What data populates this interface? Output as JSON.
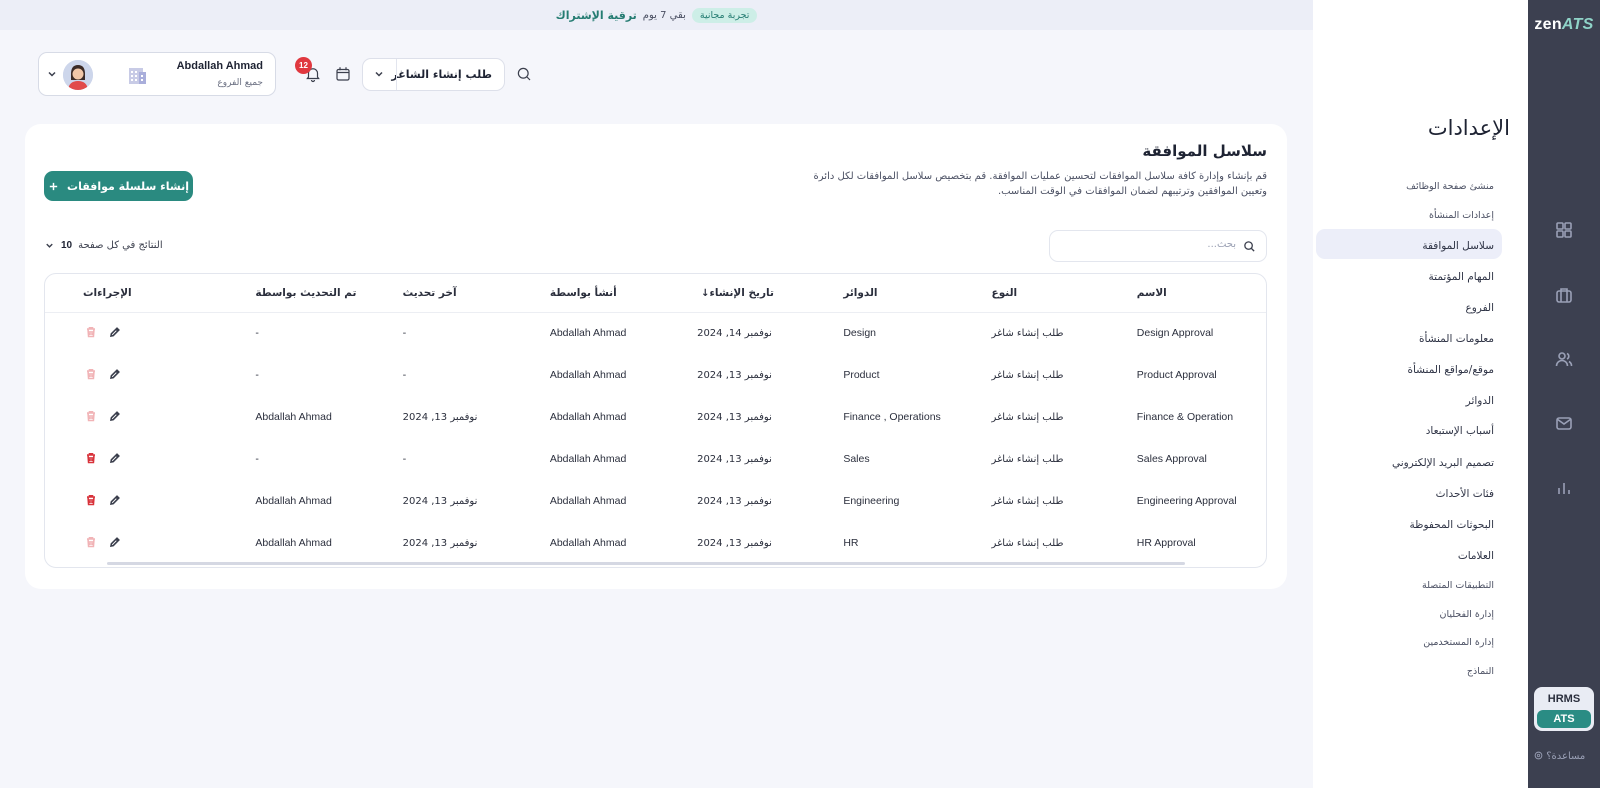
{
  "banner": {
    "trial_badge": "تجربة مجانية",
    "days_left": "بقي 7 يوم",
    "upgrade": "ترقية الإشتراك"
  },
  "brand": {
    "logo_zen": "zen",
    "logo_ats": "ATS"
  },
  "rail": {
    "icons": [
      "grid-icon",
      "briefcase-icon",
      "users-icon",
      "mail-icon",
      "chart-icon"
    ],
    "hrms": "HRMS",
    "ats": "ATS",
    "help": "مساعدة؟"
  },
  "settings": {
    "title": "الإعدادات",
    "items": [
      "منشئ صفحة الوظائف",
      "إعدادات المنشأة",
      "سلاسل الموافقة",
      "المهام المؤتمتة",
      "الفروع",
      "معلومات المنشأة",
      "موقع/مواقع المنشأة",
      "الدوائر",
      "أسباب الإستبعاد",
      "تصميم البريد الإلكتروني",
      "فئات الأحداث",
      "البحوثات المحفوظة",
      "العلامات",
      "التطبيقات المتصلة",
      "إدارة الفحليان",
      "إدارة المستخدمين",
      "النماذج"
    ],
    "active_index": 2
  },
  "header": {
    "user_name": "Abdallah Ahmad",
    "user_branch": "جميع الفروع",
    "notifications_count": "12",
    "requisition_label": "طلب إنشاء الشاغر"
  },
  "main": {
    "title": "سلاسل الموافقة",
    "description": "قم بإنشاء وإدارة كافة سلاسل الموافقات لتحسين عمليات الموافقة. قم بتخصيص سلاسل الموافقات لكل دائرة وتعيين الموافقين وترتيبهم لضمان الموافقات في الوقت المناسب.",
    "create_button": "إنشاء سلسلة موافقات",
    "search_placeholder": "بحث...",
    "per_page_label": "النتائج في كل صفحة",
    "per_page_value": "10"
  },
  "table": {
    "columns": [
      "الاسم",
      "النوع",
      "الدوائر",
      "تاريخ الإنشاء",
      "أنشأ بواسطة",
      "آخر تحديث",
      "تم التحديث بواسطة",
      "الإجراءات"
    ],
    "rows": [
      {
        "name": "Design Approval",
        "type": "طلب إنشاء شاغر",
        "departments": "Design",
        "created": "نوفمبر 14, 2024",
        "created_by": "Abdallah Ahmad",
        "updated": "-",
        "updated_by": "-",
        "delete_enabled": false
      },
      {
        "name": "Product Approval",
        "type": "طلب إنشاء شاغر",
        "departments": "Product",
        "created": "نوفمبر 13, 2024",
        "created_by": "Abdallah Ahmad",
        "updated": "-",
        "updated_by": "-",
        "delete_enabled": false
      },
      {
        "name": "Finance & Operation",
        "type": "طلب إنشاء شاغر",
        "departments": "Finance , Operations",
        "created": "نوفمبر 13, 2024",
        "created_by": "Abdallah Ahmad",
        "updated": "نوفمبر 13, 2024",
        "updated_by": "Abdallah Ahmad",
        "delete_enabled": false
      },
      {
        "name": "Sales Approval",
        "type": "طلب إنشاء شاغر",
        "departments": "Sales",
        "created": "نوفمبر 13, 2024",
        "created_by": "Abdallah Ahmad",
        "updated": "-",
        "updated_by": "-",
        "delete_enabled": true
      },
      {
        "name": "Engineering Approval",
        "type": "طلب إنشاء شاغر",
        "departments": "Engineering",
        "created": "نوفمبر 13, 2024",
        "created_by": "Abdallah Ahmad",
        "updated": "نوفمبر 13, 2024",
        "updated_by": "Abdallah Ahmad",
        "delete_enabled": true
      },
      {
        "name": "HR Approval",
        "type": "طلب إنشاء شاغر",
        "departments": "HR",
        "created": "نوفمبر 13, 2024",
        "created_by": "Abdallah Ahmad",
        "updated": "نوفمبر 13, 2024",
        "updated_by": "Abdallah Ahmad",
        "delete_enabled": false
      }
    ]
  }
}
